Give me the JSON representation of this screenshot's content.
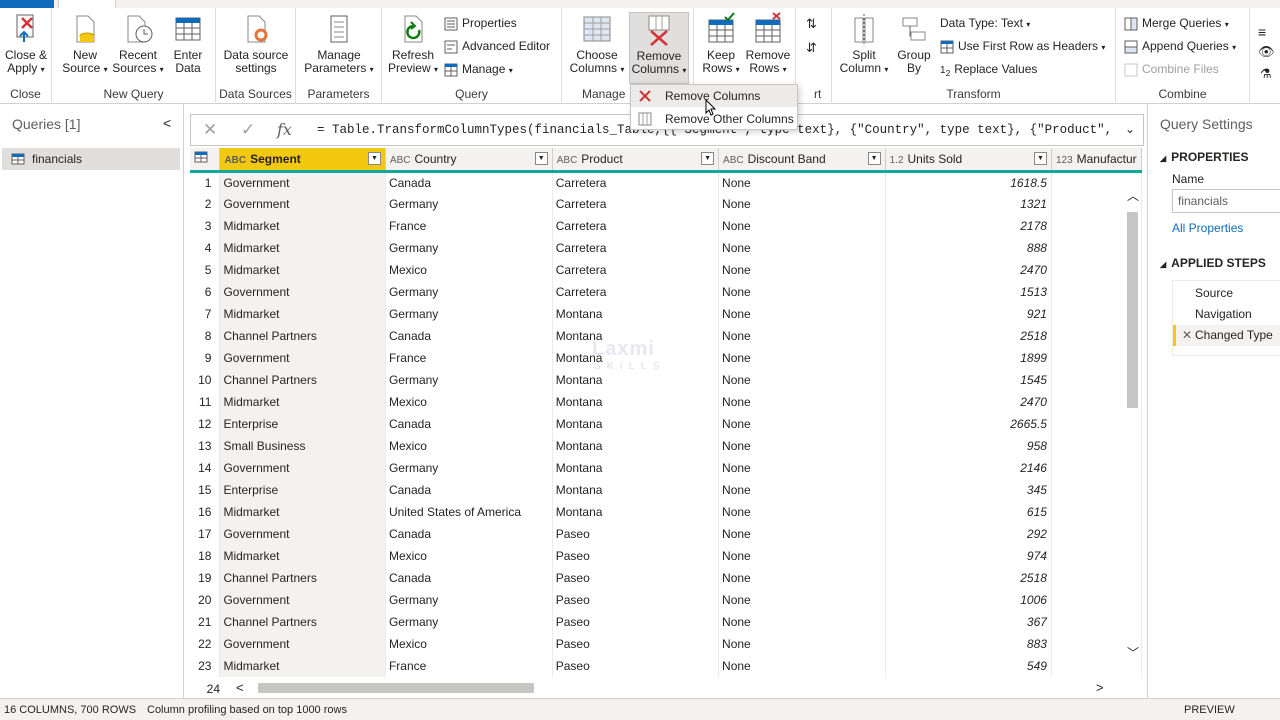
{
  "ribbon": {
    "groups": [
      {
        "label": "Close"
      },
      {
        "label": "New Query"
      },
      {
        "label": "Data Sources"
      },
      {
        "label": "Parameters"
      },
      {
        "label": "Query"
      },
      {
        "label": "Manage"
      },
      {
        "label": "Transform"
      },
      {
        "label": "Combine"
      }
    ],
    "close_apply": "Close &",
    "close_apply2": "Apply",
    "new_source": "New",
    "new_source2": "Source",
    "recent_sources": "Recent",
    "recent_sources2": "Sources",
    "enter_data": "Enter",
    "enter_data2": "Data",
    "ds_settings": "Data source",
    "ds_settings2": "settings",
    "manage_params": "Manage",
    "manage_params2": "Parameters",
    "refresh_preview": "Refresh",
    "refresh_preview2": "Preview",
    "properties": "Properties",
    "advanced_editor": "Advanced Editor",
    "manage": "Manage",
    "choose_columns": "Choose",
    "choose_columns2": "Columns",
    "remove_columns": "Remove",
    "remove_columns2": "Columns",
    "keep_rows": "Keep",
    "keep_rows2": "Rows",
    "remove_rows": "Remove",
    "remove_rows2": "Rows",
    "split_column": "Split",
    "split_column2": "Column",
    "group_by": "Group",
    "group_by2": "By",
    "data_type": "Data Type: Text",
    "first_row_headers": "Use First Row as Headers",
    "replace_values": "Replace Values",
    "merge_queries": "Merge Queries",
    "append_queries": "Append Queries",
    "combine_files": "Combine Files",
    "sort_partial": "rt"
  },
  "menu": {
    "items": [
      "Remove Columns",
      "Remove Other Columns"
    ]
  },
  "queries": {
    "title": "Queries [1]",
    "items": [
      "financials"
    ]
  },
  "formula": {
    "text": "= Table.TransformColumnTypes(financials_Table,{{\"Segment\", type text}, {\"Country\", type text}, {\"Product\", type"
  },
  "grid": {
    "columns": [
      {
        "type": "ABC",
        "name": "Segment"
      },
      {
        "type": "ABC",
        "name": "Country"
      },
      {
        "type": "ABC",
        "name": "Product"
      },
      {
        "type": "ABC",
        "name": "Discount Band"
      },
      {
        "type": "1.2",
        "name": "Units Sold"
      },
      {
        "type": "123",
        "name": "Manufactur"
      }
    ],
    "rows": [
      [
        "1",
        "Government",
        "Canada",
        "Carretera",
        "None",
        "1618.5"
      ],
      [
        "2",
        "Government",
        "Germany",
        "Carretera",
        "None",
        "1321"
      ],
      [
        "3",
        "Midmarket",
        "France",
        "Carretera",
        "None",
        "2178"
      ],
      [
        "4",
        "Midmarket",
        "Germany",
        "Carretera",
        "None",
        "888"
      ],
      [
        "5",
        "Midmarket",
        "Mexico",
        "Carretera",
        "None",
        "2470"
      ],
      [
        "6",
        "Government",
        "Germany",
        "Carretera",
        "None",
        "1513"
      ],
      [
        "7",
        "Midmarket",
        "Germany",
        "Montana",
        "None",
        "921"
      ],
      [
        "8",
        "Channel Partners",
        "Canada",
        "Montana",
        "None",
        "2518"
      ],
      [
        "9",
        "Government",
        "France",
        "Montana",
        "None",
        "1899"
      ],
      [
        "10",
        "Channel Partners",
        "Germany",
        "Montana",
        "None",
        "1545"
      ],
      [
        "11",
        "Midmarket",
        "Mexico",
        "Montana",
        "None",
        "2470"
      ],
      [
        "12",
        "Enterprise",
        "Canada",
        "Montana",
        "None",
        "2665.5"
      ],
      [
        "13",
        "Small Business",
        "Mexico",
        "Montana",
        "None",
        "958"
      ],
      [
        "14",
        "Government",
        "Germany",
        "Montana",
        "None",
        "2146"
      ],
      [
        "15",
        "Enterprise",
        "Canada",
        "Montana",
        "None",
        "345"
      ],
      [
        "16",
        "Midmarket",
        "United States of America",
        "Montana",
        "None",
        "615"
      ],
      [
        "17",
        "Government",
        "Canada",
        "Paseo",
        "None",
        "292"
      ],
      [
        "18",
        "Midmarket",
        "Mexico",
        "Paseo",
        "None",
        "974"
      ],
      [
        "19",
        "Channel Partners",
        "Canada",
        "Paseo",
        "None",
        "2518"
      ],
      [
        "20",
        "Government",
        "Germany",
        "Paseo",
        "None",
        "1006"
      ],
      [
        "21",
        "Channel Partners",
        "Germany",
        "Paseo",
        "None",
        "367"
      ],
      [
        "22",
        "Government",
        "Mexico",
        "Paseo",
        "None",
        "883"
      ],
      [
        "23",
        "Midmarket",
        "France",
        "Paseo",
        "None",
        "549"
      ]
    ],
    "partial_row": "24"
  },
  "settings": {
    "title": "Query Settings",
    "properties_heading": "PROPERTIES",
    "name_label": "Name",
    "name_value": "financials",
    "all_properties": "All Properties",
    "steps_heading": "APPLIED STEPS",
    "steps": [
      "Source",
      "Navigation",
      "Changed Type"
    ]
  },
  "status": {
    "counts": "16 COLUMNS, 700 ROWS",
    "profiling": "Column profiling based on top 1000 rows",
    "preview": "PREVIEW DOWNLO"
  },
  "watermark": {
    "line1": "Laxmi",
    "line2": "SKILLS"
  },
  "colors": {
    "accent": "#f2c811",
    "header_rule": "#13a89e",
    "link": "#0f6cbd"
  }
}
